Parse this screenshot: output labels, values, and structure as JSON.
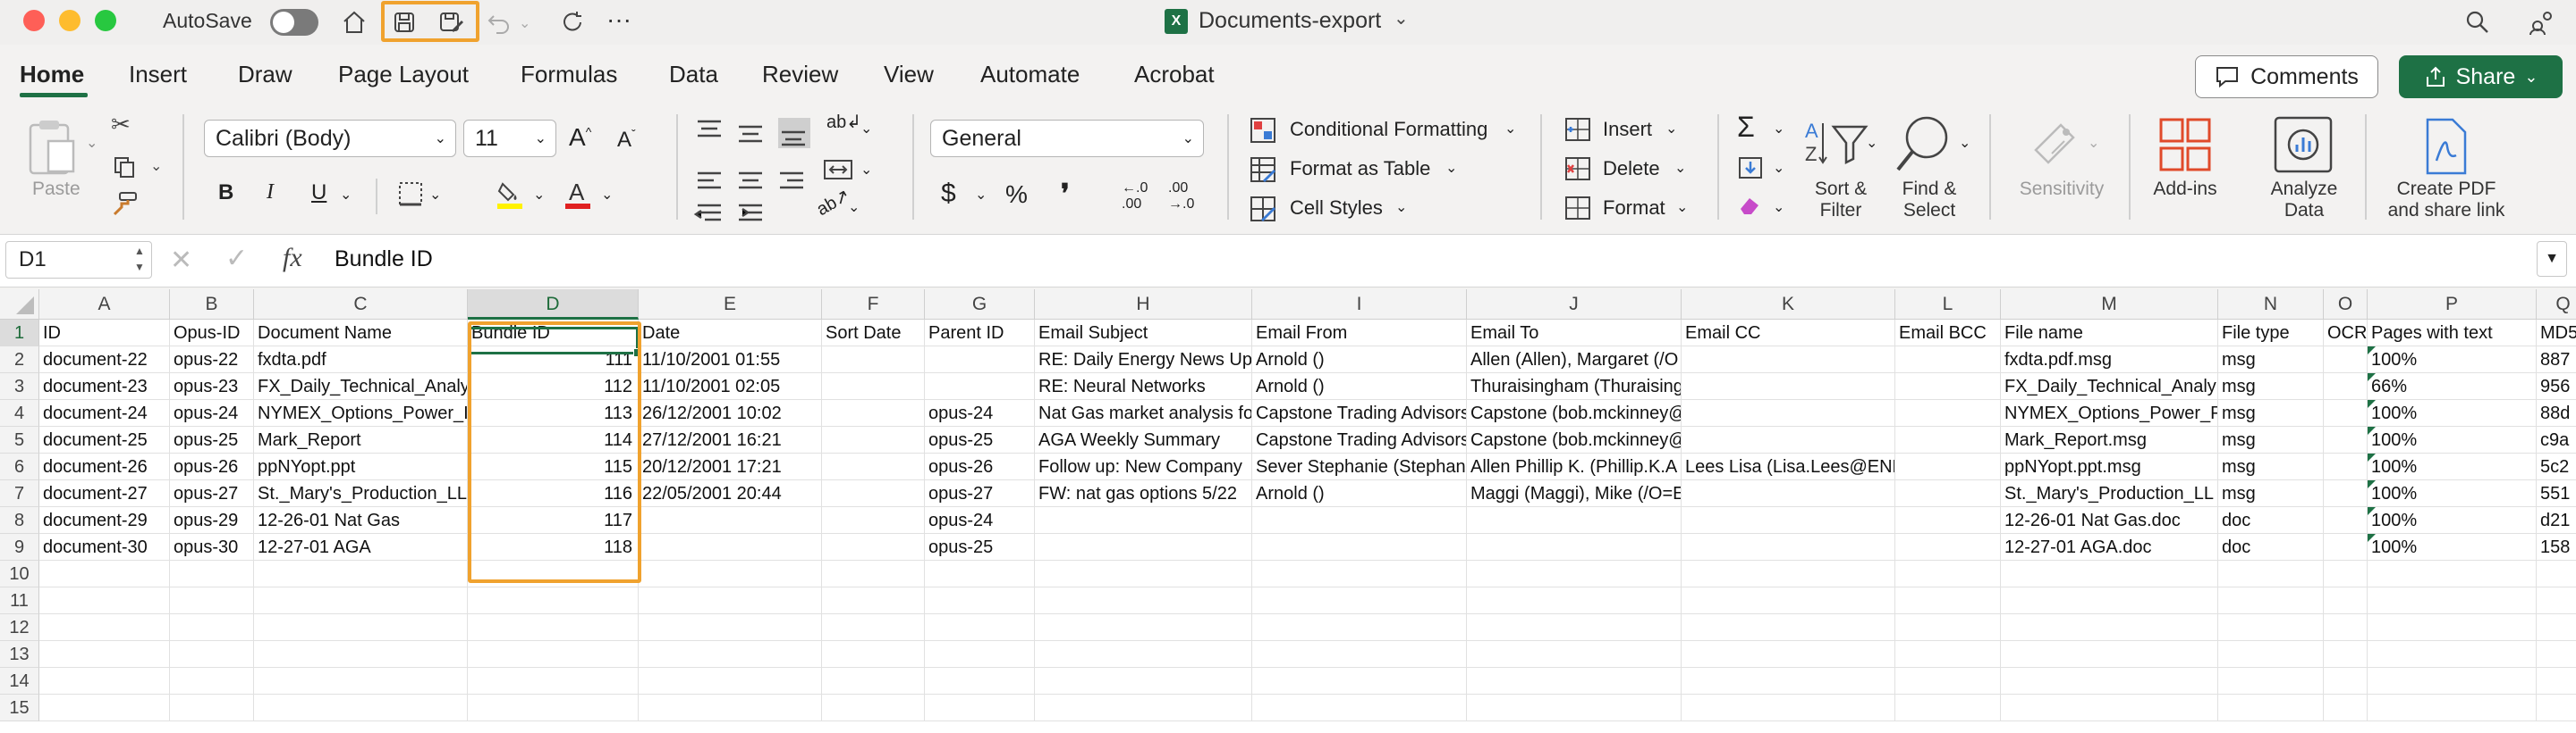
{
  "window": {
    "autosave_label": "AutoSave",
    "title": "Documents-export",
    "more": "···"
  },
  "ribbon_tabs": [
    "Home",
    "Insert",
    "Draw",
    "Page Layout",
    "Formulas",
    "Data",
    "Review",
    "View",
    "Automate",
    "Acrobat"
  ],
  "actions": {
    "comments": "Comments",
    "share": "Share"
  },
  "ribbon": {
    "paste": "Paste",
    "font_name": "Calibri (Body)",
    "font_size": "11",
    "number_format": "General",
    "conditional_formatting": "Conditional Formatting",
    "format_as_table": "Format as Table",
    "cell_styles": "Cell Styles",
    "insert": "Insert",
    "delete": "Delete",
    "format": "Format",
    "sort_filter_1": "Sort &",
    "sort_filter_2": "Filter",
    "find_select_1": "Find &",
    "find_select_2": "Select",
    "sensitivity": "Sensitivity",
    "add_ins": "Add-ins",
    "analyze_1": "Analyze",
    "analyze_2": "Data",
    "create_pdf_1": "Create PDF",
    "create_pdf_2": "and share link",
    "bold": "B",
    "italic": "I",
    "underline": "U",
    "grow_font": "A^",
    "shrink_font": "Aˇ",
    "currency": "$",
    "percent": "%",
    "comma": "❜",
    "inc_decimal": "←.0 .00",
    "dec_decimal": ".00 →.0"
  },
  "formula_bar": {
    "name_box": "D1",
    "fx": "fx",
    "content": "Bundle ID"
  },
  "columns": [
    "A",
    "B",
    "C",
    "D",
    "E",
    "F",
    "G",
    "H",
    "I",
    "J",
    "K",
    "L",
    "M",
    "N",
    "O",
    "P",
    "Q"
  ],
  "row_numbers": [
    "1",
    "2",
    "3",
    "4",
    "5",
    "6",
    "7",
    "8",
    "9",
    "10",
    "11",
    "12",
    "13",
    "14",
    "15"
  ],
  "rows": [
    [
      "ID",
      "Opus-ID",
      "Document Name",
      "Bundle ID",
      "Date",
      "Sort Date",
      "Parent ID",
      "Email Subject",
      "Email From",
      "Email To",
      "Email CC",
      "Email BCC",
      "File name",
      "File type",
      "OCR",
      "Pages with text",
      "MD5"
    ],
    [
      "document-22",
      "opus-22",
      "fxdta.pdf",
      "111",
      "11/10/2001 01:55",
      "",
      "",
      "RE: Daily Energy News Upd",
      "Arnold ()",
      "Allen (Allen), Margaret (/O",
      "",
      "",
      "fxdta.pdf.msg",
      "msg",
      "",
      "100%",
      "887"
    ],
    [
      "document-23",
      "opus-23",
      "FX_Daily_Technical_Analy",
      "112",
      "11/10/2001 02:05",
      "",
      "",
      "RE: Neural Networks",
      "Arnold ()",
      "Thuraisingham (Thuraising",
      "",
      "",
      "FX_Daily_Technical_Analy",
      "msg",
      "",
      "66%",
      "956"
    ],
    [
      "document-24",
      "opus-24",
      "NYMEX_Options_Power_I",
      "113",
      "26/12/2001 10:02",
      "",
      "opus-24",
      "Nat Gas market analysis fo",
      "Capstone Trading Advisors",
      "Capstone (bob.mckinney@",
      "",
      "",
      "NYMEX_Options_Power_P",
      "msg",
      "",
      "100%",
      "88d"
    ],
    [
      "document-25",
      "opus-25",
      "Mark_Report",
      "114",
      "27/12/2001 16:21",
      "",
      "opus-25",
      "AGA Weekly Summary",
      "Capstone Trading Advisors",
      "Capstone (bob.mckinney@",
      "",
      "",
      "Mark_Report.msg",
      "msg",
      "",
      "100%",
      "c9a"
    ],
    [
      "document-26",
      "opus-26",
      "ppNYopt.ppt",
      "115",
      "20/12/2001 17:21",
      "",
      "opus-26",
      "Follow up:  New Company",
      "Sever  Stephanie (Stephani",
      "Allen  Phillip K. (Phillip.K.A",
      "Lees  Lisa (Lisa.Lees@ENRC",
      "",
      "ppNYopt.ppt.msg",
      "msg",
      "",
      "100%",
      "5c2"
    ],
    [
      "document-27",
      "opus-27",
      "St._Mary's_Production_LL",
      "116",
      "22/05/2001 20:44",
      "",
      "opus-27",
      "FW: nat gas options 5/22",
      "Arnold ()",
      "Maggi (Maggi), Mike (/O=EI",
      "",
      "",
      "St._Mary's_Production_LL",
      "msg",
      "",
      "100%",
      "551"
    ],
    [
      "document-29",
      "opus-29",
      "12-26-01 Nat Gas",
      "117",
      "",
      "",
      "opus-24",
      "",
      "",
      "",
      "",
      "",
      "12-26-01 Nat Gas.doc",
      "doc",
      "",
      "100%",
      "d21"
    ],
    [
      "document-30",
      "opus-30",
      "12-27-01 AGA",
      "118",
      "",
      "",
      "opus-25",
      "",
      "",
      "",
      "",
      "",
      "12-27-01 AGA.doc",
      "doc",
      "",
      "100%",
      "158"
    ]
  ]
}
